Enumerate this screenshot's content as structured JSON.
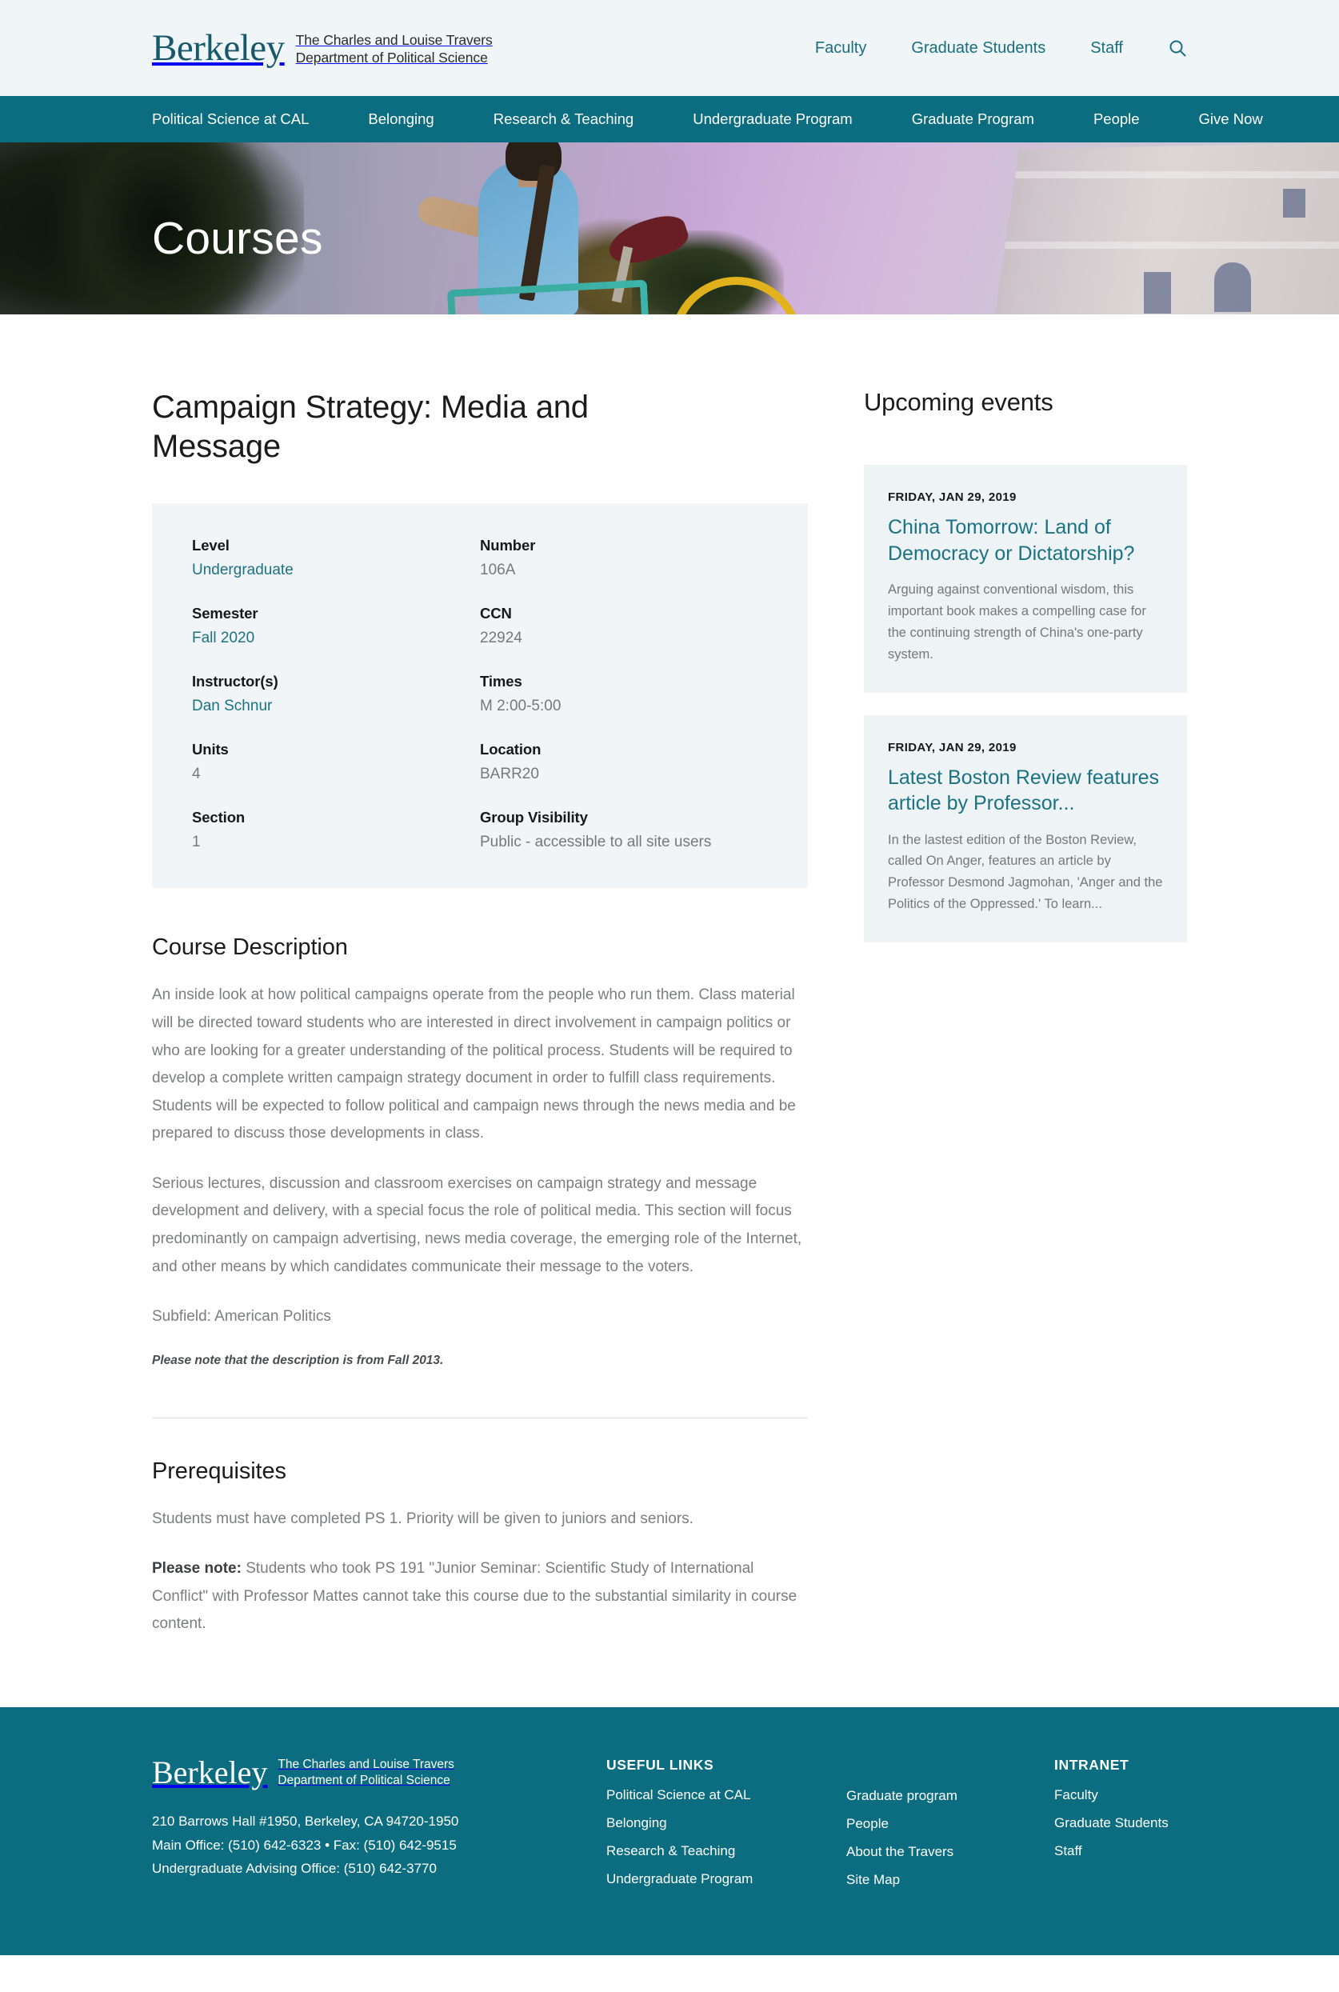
{
  "header": {
    "logo_wordmark": "Berkeley",
    "dept_line1": "The Charles and Louise Travers",
    "dept_line2": "Department of Political Science",
    "util_nav": [
      {
        "label": "Faculty"
      },
      {
        "label": "Graduate Students"
      },
      {
        "label": "Staff"
      }
    ],
    "search_icon": "search-icon"
  },
  "main_nav": [
    {
      "label": "Political Science at CAL"
    },
    {
      "label": "Belonging"
    },
    {
      "label": "Research & Teaching"
    },
    {
      "label": "Undergraduate Program"
    },
    {
      "label": "Graduate Program"
    },
    {
      "label": "People"
    },
    {
      "label": "Give Now"
    }
  ],
  "hero": {
    "title": "Courses"
  },
  "course": {
    "title": "Campaign Strategy: Media and Message",
    "info_left": [
      {
        "label": "Level",
        "value": "Undergraduate",
        "is_link": true
      },
      {
        "label": "Semester",
        "value": "Fall 2020",
        "is_link": true
      },
      {
        "label": "Instructor(s)",
        "value": "Dan Schnur",
        "is_link": true
      },
      {
        "label": "Units",
        "value": "4",
        "is_link": false
      },
      {
        "label": "Section",
        "value": "1",
        "is_link": false
      }
    ],
    "info_right": [
      {
        "label": "Number",
        "value": "106A",
        "is_link": false
      },
      {
        "label": "CCN",
        "value": "22924",
        "is_link": false
      },
      {
        "label": "Times",
        "value": "M 2:00-5:00",
        "is_link": false
      },
      {
        "label": "Location",
        "value": "BARR20",
        "is_link": false
      },
      {
        "label": "Group Visibility",
        "value": "Public - accessible to all site users",
        "is_link": false
      }
    ],
    "description_heading": "Course Description",
    "description_p1": "An inside look at how political campaigns operate from the people who run them. Class material will be directed toward students who are interested in direct involvement in campaign politics or who are looking for a greater understanding of the political process. Students will be required to develop a complete written campaign strategy document in order to fulfill class requirements. Students will be expected to follow political and campaign news through the news media and be prepared to discuss those developments in class.",
    "description_p2": "Serious lectures, discussion and classroom exercises on campaign strategy and message development and delivery, with a special focus the role of political media. This section will focus predominantly on campaign advertising, news media coverage, the emerging role of the Internet, and other means by which candidates communicate their message to the voters.",
    "subfield": "Subfield: American Politics",
    "description_note": "Please note that the description is from Fall 2013.",
    "prereq_heading": "Prerequisites",
    "prereq_p1": "Students must have completed PS 1. Priority will be given to juniors and seniors.",
    "prereq_note_bold": "Please note:",
    "prereq_note_rest": " Students who took PS 191 \"Junior Seminar: Scientific Study of International Conflict\" with Professor Mattes cannot take this course due to the substantial similarity in course content."
  },
  "sidebar": {
    "heading": "Upcoming events",
    "events": [
      {
        "date": "FRIDAY, JAN 29, 2019",
        "title": "China Tomorrow: Land of Democracy or Dictatorship?",
        "desc": "Arguing against conventional wisdom, this important book makes a compelling case for the continuing strength of China's one-party system."
      },
      {
        "date": "FRIDAY, JAN 29, 2019",
        "title": "Latest Boston Review features article by Professor...",
        "desc": "In the lastest edition of the Boston Review, called On Anger, features an article by Professor Desmond Jagmohan, 'Anger and the Politics of the Oppressed.' To learn..."
      }
    ]
  },
  "footer": {
    "logo_wordmark": "Berkeley",
    "dept_line1": "The Charles and Louise Travers",
    "dept_line2": "Department of Political Science",
    "address": "210 Barrows Hall #1950, Berkeley, CA 94720-1950",
    "phone": "Main Office: (510) 642-6323 • Fax: (510) 642-9515",
    "advising": "Undergraduate Advising Office: (510) 642-3770",
    "useful_title": "USEFUL LINKS",
    "useful_col1": [
      {
        "label": "Political Science at CAL"
      },
      {
        "label": "Belonging"
      },
      {
        "label": "Research & Teaching"
      },
      {
        "label": "Undergraduate Program"
      }
    ],
    "useful_col2": [
      {
        "label": "Graduate program"
      },
      {
        "label": "People"
      },
      {
        "label": "About the Travers"
      },
      {
        "label": "Site Map"
      }
    ],
    "intranet_title": "INTRANET",
    "intranet_links": [
      {
        "label": "Faculty"
      },
      {
        "label": "Graduate Students"
      },
      {
        "label": "Staff"
      }
    ]
  },
  "colors": {
    "teal": "#0b6d7f",
    "link_teal": "#1a7283",
    "header_bg": "#f0f5f8",
    "info_bg": "#f2f5f8",
    "card_bg": "#eef3f6"
  }
}
